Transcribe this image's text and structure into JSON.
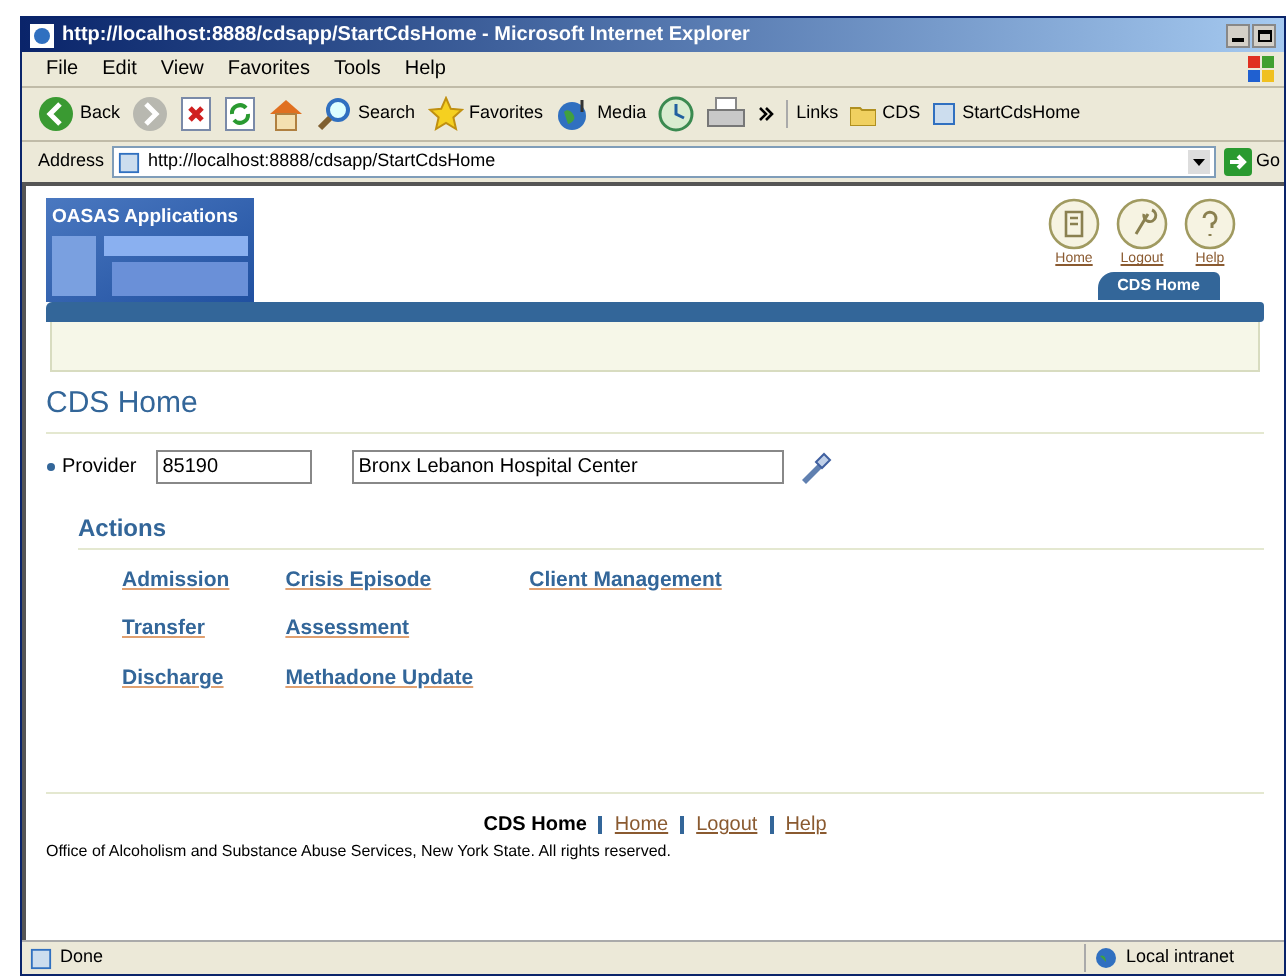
{
  "window": {
    "title": "http://localhost:8888/cdsapp/StartCdsHome - Microsoft Internet Explorer"
  },
  "menu": [
    "File",
    "Edit",
    "View",
    "Favorites",
    "Tools",
    "Help"
  ],
  "toolbar": [
    {
      "kind": "back",
      "label": "Back"
    },
    {
      "kind": "forward"
    },
    {
      "kind": "stop"
    },
    {
      "kind": "refresh"
    },
    {
      "kind": "home"
    },
    {
      "kind": "search",
      "label": "Search"
    },
    {
      "kind": "favorites",
      "label": "Favorites"
    },
    {
      "kind": "media",
      "label": "Media"
    },
    {
      "kind": "history"
    },
    {
      "kind": "print"
    }
  ],
  "links": {
    "label": "Links",
    "items": [
      {
        "kind": "folder",
        "label": "CDS"
      },
      {
        "kind": "page",
        "label": "StartCdsHome"
      }
    ]
  },
  "address": {
    "label": "Address",
    "value": "http://localhost:8888/cdsapp/StartCdsHome",
    "go": "Go"
  },
  "app": {
    "brand": "OASAS Applications",
    "global_links": [
      {
        "kind": "home",
        "label": "Home"
      },
      {
        "kind": "logout",
        "label": "Logout"
      },
      {
        "kind": "help",
        "label": "Help"
      }
    ],
    "tabs": [
      {
        "label": "CDS Home",
        "selected": true
      }
    ],
    "page_title": "CDS Home",
    "provider": {
      "label": "Provider",
      "required": true,
      "id": "85190",
      "name": "Bronx Lebanon Hospital Center"
    },
    "actions_title": "Actions",
    "actions": [
      [
        "Admission",
        "Transfer",
        "Discharge"
      ],
      [
        "Crisis Episode",
        "Assessment",
        "Methadone Update"
      ],
      [
        "Client Management"
      ]
    ],
    "footer": {
      "current": "CDS Home",
      "links": [
        "Home",
        "Logout",
        "Help"
      ],
      "copyright": "Office of Alcoholism and Substance Abuse Services, New York State. All rights reserved."
    }
  },
  "status_bar": {
    "text": "Done",
    "zone": "Local intranet"
  }
}
